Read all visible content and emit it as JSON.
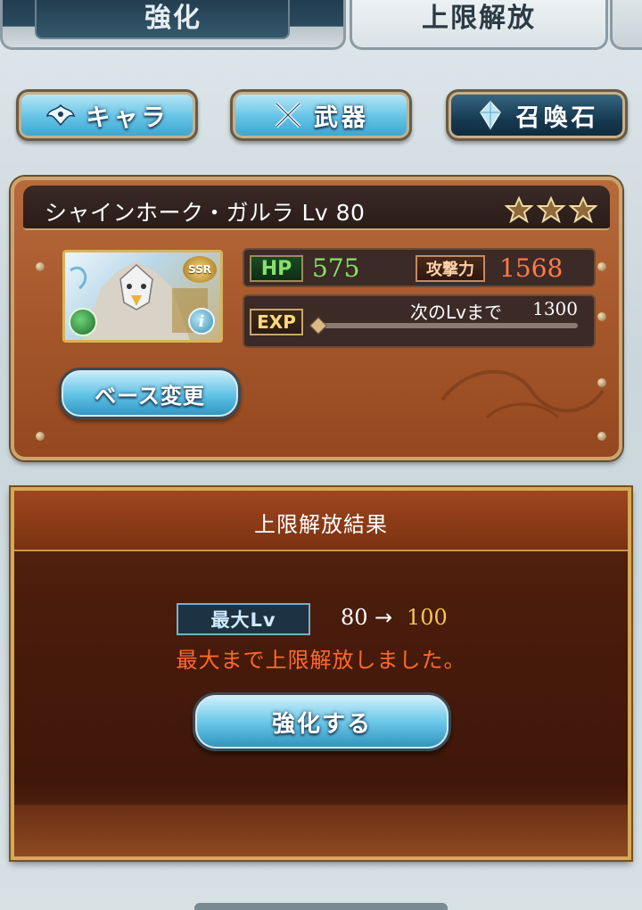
{
  "tabs": {
    "enhance": "強化",
    "limit_break": "上限解放"
  },
  "categories": {
    "character": "キャラ",
    "weapon": "武器",
    "summon": "召喚石"
  },
  "character": {
    "name": "シャインホーク・ガルラ Lv 80",
    "rarity": "SSR",
    "stars": 3,
    "hp_label": "HP",
    "hp": "575",
    "atk_label": "攻撃力",
    "atk": "1568",
    "exp_label": "EXP",
    "next_lv_label": "次のLvまで",
    "next_lv_value": "1300",
    "exp_progress": 0.0,
    "info_icon": "i",
    "base_change": "ベース変更"
  },
  "result": {
    "title": "上限解放結果",
    "max_lv_label": "最大Lv",
    "lv_from": "80",
    "arrow": "→",
    "lv_to": "100",
    "message": "最大まで上限解放しました。",
    "enhance_button": "強化する"
  },
  "colors": {
    "hp": "#86e26b",
    "atk": "#ff7b4a",
    "lv_to": "#f7c652",
    "message": "#ff6a2a",
    "panel_brown": "#a6582c",
    "button_blue": "#5ec2e6"
  }
}
